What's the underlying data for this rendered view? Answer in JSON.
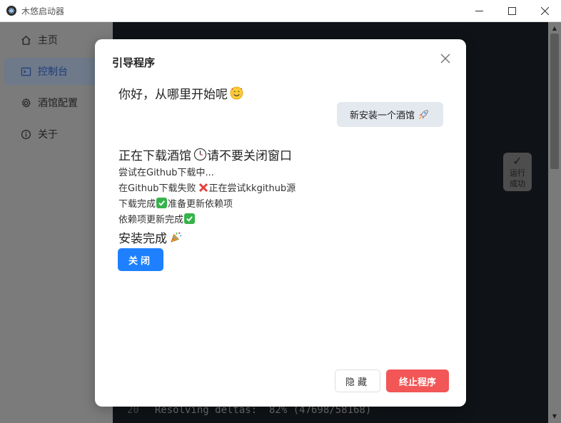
{
  "window": {
    "title": "木悠启动器",
    "minimize_icon": "minimize-icon",
    "maximize_icon": "maximize-icon",
    "close_icon": "close-icon"
  },
  "sidebar": {
    "items": [
      {
        "label": "主页",
        "icon": "home-icon",
        "active": false
      },
      {
        "label": "控制台",
        "icon": "console-icon",
        "active": true
      },
      {
        "label": "酒馆配置",
        "icon": "gear-icon",
        "active": false
      },
      {
        "label": "关于",
        "icon": "info-icon",
        "active": false
      }
    ]
  },
  "console": {
    "line_number": "20",
    "line_text": "Resolving deltas:  82% (47698/58168)"
  },
  "run_badge": {
    "check": "✓",
    "line1": "运行",
    "line2": "成功"
  },
  "modal": {
    "title": "引导程序",
    "greeting": "你好，从哪里开始呢",
    "new_install_button": "新安装一个酒馆",
    "downloading_heading_a": "正在下载酒馆",
    "downloading_heading_b": "请不要关闭窗口",
    "log": {
      "line1": "尝试在Github下载中...",
      "line2_a": "在Github下载失败",
      "line2_b": "正在尝试kkgithub源",
      "line3_a": "下载完成",
      "line3_b": "准备更新依赖项",
      "line4": "依赖项更新完成"
    },
    "complete_text": "安装完成",
    "close_button": "关闭",
    "hide_button": "隐藏",
    "stop_button": "终止程序"
  },
  "colors": {
    "primary": "#1e80ff",
    "danger": "#f25656",
    "success": "#36b34a"
  }
}
